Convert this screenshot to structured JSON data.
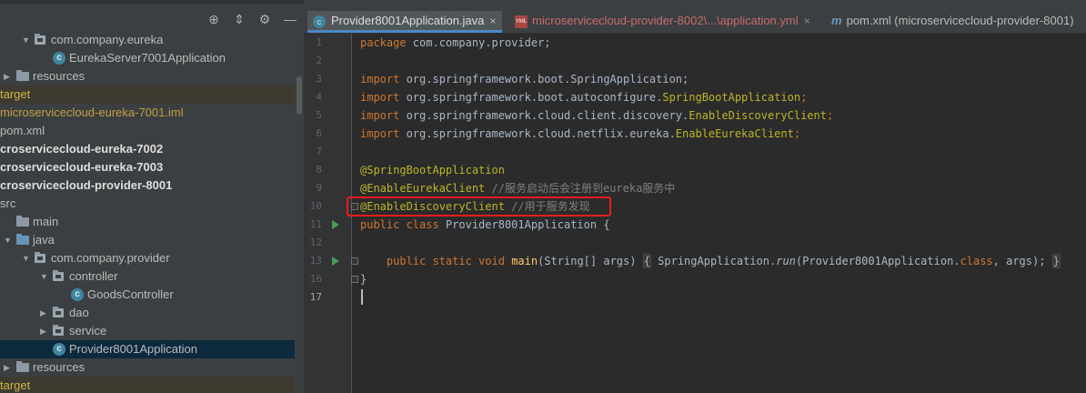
{
  "project_tree": [
    {
      "label": "com.company.eureka",
      "icon": "package-folder-icon",
      "arrow": "down",
      "style": ""
    },
    {
      "label": "EurekaServer7001Application",
      "icon": "java-class-icon",
      "arrow": "",
      "style": ""
    },
    {
      "label": "resources",
      "icon": "folder-icon",
      "arrow": "right",
      "style": ""
    },
    {
      "label": "target",
      "icon": "",
      "arrow": "",
      "style": "excluded"
    },
    {
      "label": "microservicecloud-eureka-7001.iml",
      "icon": "",
      "arrow": "",
      "style": "iml"
    },
    {
      "label": "pom.xml",
      "icon": "",
      "arrow": "",
      "style": ""
    },
    {
      "label": "croservicecloud-eureka-7002",
      "icon": "",
      "arrow": "",
      "style": "bold"
    },
    {
      "label": "croservicecloud-eureka-7003",
      "icon": "",
      "arrow": "",
      "style": "bold"
    },
    {
      "label": "croservicecloud-provider-8001",
      "icon": "",
      "arrow": "",
      "style": "bold"
    },
    {
      "label": "src",
      "icon": "",
      "arrow": "",
      "style": ""
    },
    {
      "label": "main",
      "icon": "folder-icon",
      "arrow": "",
      "style": ""
    },
    {
      "label": "java",
      "icon": "source-folder-icon",
      "arrow": "down",
      "style": ""
    },
    {
      "label": "com.company.provider",
      "icon": "package-folder-icon",
      "arrow": "down",
      "style": ""
    },
    {
      "label": "controller",
      "icon": "package-folder-icon",
      "arrow": "down",
      "style": ""
    },
    {
      "label": "GoodsController",
      "icon": "java-class-icon",
      "arrow": "",
      "style": ""
    },
    {
      "label": "dao",
      "icon": "package-folder-icon",
      "arrow": "right",
      "style": ""
    },
    {
      "label": "service",
      "icon": "package-folder-icon",
      "arrow": "right",
      "style": ""
    },
    {
      "label": "Provider8001Application",
      "icon": "java-class-icon",
      "arrow": "",
      "style": "selected"
    },
    {
      "label": "resources",
      "icon": "folder-icon",
      "arrow": "right",
      "style": ""
    },
    {
      "label": "target",
      "icon": "",
      "arrow": "",
      "style": "excluded"
    }
  ],
  "tabs": {
    "tab1": {
      "label": "Provider8001Application.java",
      "icon": "java-class-icon",
      "close": "×"
    },
    "tab2": {
      "label": "microservicecloud-provider-8002\\...\\application.yml",
      "icon": "yml-file-icon",
      "close": "×"
    },
    "tab3": {
      "label": "pom.xml (microservicecloud-provider-8001)",
      "icon": "maven-icon",
      "icon_text": "m"
    }
  },
  "editor": {
    "line_numbers": [
      "1",
      "2",
      "3",
      "4",
      "5",
      "6",
      "7",
      "8",
      "9",
      "10",
      "11",
      "12",
      "13",
      "16",
      "17"
    ],
    "current_line": "17",
    "run_gutter_lines": [
      "11",
      "13"
    ],
    "line1_kw": "package",
    "line1_rest": " com.company.provider;",
    "line3_kw": "import",
    "line3_rest": " org.springframework.boot.SpringApplication;",
    "line4_kw": "import",
    "line4_pre": " org.springframework.boot.autoconfigure.",
    "line4_ann": "SpringBootApplication",
    "line4_end": ";",
    "line5_kw": "import",
    "line5_pre": " org.springframework.cloud.client.discovery.",
    "line5_ann": "EnableDiscoveryClient",
    "line5_end": ";",
    "line6_kw": "import",
    "line6_pre": " org.springframework.cloud.netflix.eureka.",
    "line6_ann": "EnableEurekaClient",
    "line6_end": ";",
    "line8_ann": "@SpringBootApplication",
    "line9_ann": "@EnableEurekaClient",
    "line9_cm": " //服务启动后会注册到eureka服务中",
    "line10_ann": "@EnableDiscoveryClient",
    "line10_cm": " //用于服务发现",
    "line11_kw": "public class",
    "line11_rest": " Provider8001Application {",
    "line13_kw": "public static void",
    "line13_mth": "main",
    "line13_args": "(String[] args)",
    "line13_ob": "{",
    "line13_body_pre": " SpringApplication.",
    "line13_run": "run",
    "line13_body_mid": "(Provider8001Application.",
    "line13_class": "class",
    "line13_body_end": ", args);",
    "line13_cb": "}",
    "line16": "}"
  },
  "colors": {
    "keyword": "#cc7832",
    "annotation": "#bbb529",
    "comment": "#808080",
    "highlight_box": "#ec1c1c",
    "accent": "#4a88c7"
  }
}
